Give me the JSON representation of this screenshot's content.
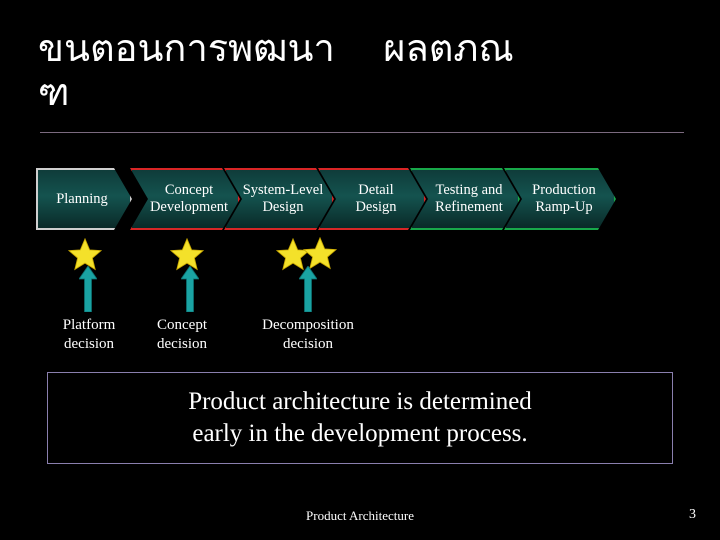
{
  "slide": {
    "title": "ขนตอนการพฒนา    ผลตภณ\nฑ",
    "process": {
      "steps": [
        {
          "label": "Planning",
          "outline": "#cfcfcf"
        },
        {
          "label": "Concept\nDevelopment",
          "outline": "#d82626"
        },
        {
          "label": "System-Level\nDesign",
          "outline": "#d82626"
        },
        {
          "label": "Detail\nDesign",
          "outline": "#d82626"
        },
        {
          "label": "Testing and\nRefinement",
          "outline": "#18a84a"
        },
        {
          "label": "Production\nRamp-Up",
          "outline": "#18a84a"
        }
      ]
    },
    "markers": {
      "star_count": 4,
      "star_color": "#f4e12a",
      "arrow_color": "#1aa3a3"
    },
    "decisions": [
      {
        "label": "Platform\ndecision"
      },
      {
        "label": "Concept\ndecision"
      },
      {
        "label": "Decomposition\ndecision"
      }
    ],
    "callout": {
      "text": "Product architecture is determined\nearly in the development process.",
      "border_color": "#8a7fae"
    },
    "footer": {
      "text": "Product Architecture",
      "page": "3"
    }
  }
}
